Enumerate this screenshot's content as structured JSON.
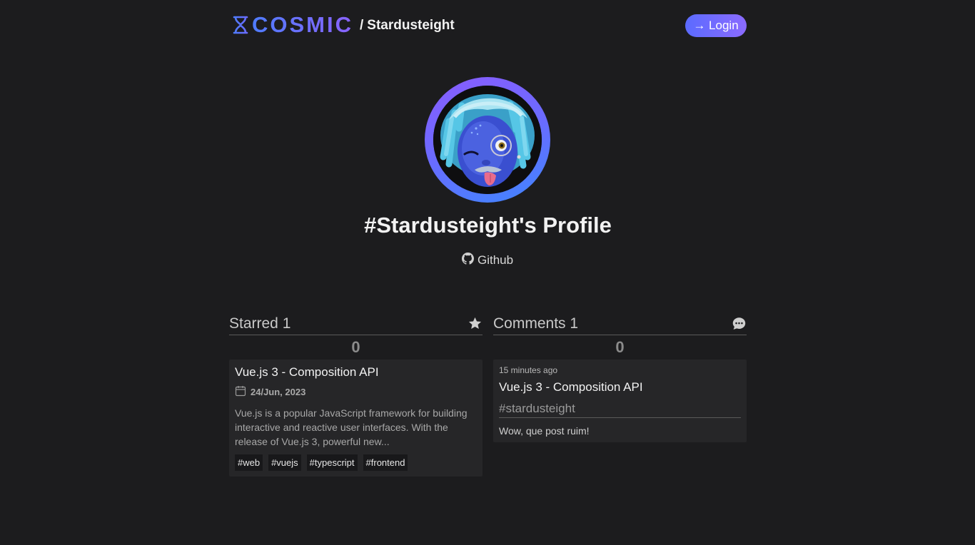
{
  "header": {
    "brand": "COSMIC",
    "separator": "/",
    "username": "Stardusteight",
    "login_label": "→ Login"
  },
  "profile": {
    "title": "#Stardusteight's Profile",
    "github_label": "Github"
  },
  "starred": {
    "title": "Starred 1",
    "count": "0",
    "post": {
      "title": "Vue.js 3 - Composition API",
      "date": "24/Jun, 2023",
      "excerpt": "Vue.js is a popular JavaScript framework for building interactive and reactive user interfaces. With the release of Vue.js 3, powerful new...",
      "tags": [
        "#web",
        "#vuejs",
        "#typescript",
        "#frontend"
      ]
    }
  },
  "comments": {
    "title": "Comments 1",
    "count": "0",
    "comment": {
      "time": "15 minutes ago",
      "post_title": "Vue.js 3 - Composition API",
      "author_tag": "#stardusteight",
      "text": "Wow, que post ruim!"
    }
  },
  "colors": {
    "background": "#1c1c1e",
    "accent_blue": "#4f7cff",
    "accent_purple": "#8a63ff",
    "card": "#262628"
  },
  "icons": {
    "brand": "hourglass-icon",
    "github": "github-icon",
    "starred": "star-icon",
    "comments": "chat-bubble-icon",
    "date": "calendar-icon"
  }
}
